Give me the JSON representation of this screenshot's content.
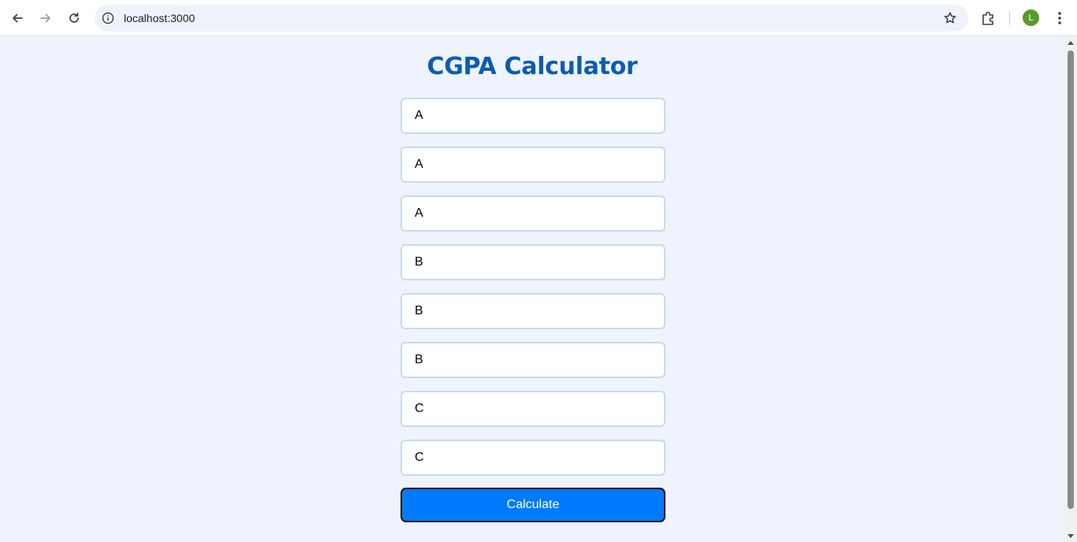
{
  "browser": {
    "url": "localhost:3000",
    "avatar_letter": "L",
    "icons": [
      "back-icon",
      "forward-icon",
      "reload-icon",
      "info-icon",
      "star-icon",
      "extensions-icon",
      "kebab-menu-icon"
    ]
  },
  "page": {
    "title": "CGPA Calculator",
    "grades": [
      "A",
      "A",
      "A",
      "B",
      "B",
      "B",
      "C",
      "C"
    ],
    "calculate_label": "Calculate"
  },
  "colors": {
    "title": "#0b5cb0",
    "button": "#007bff",
    "background": "#eef3fd",
    "input_border": "#c7dbef",
    "avatar": "#5a9a2c"
  }
}
